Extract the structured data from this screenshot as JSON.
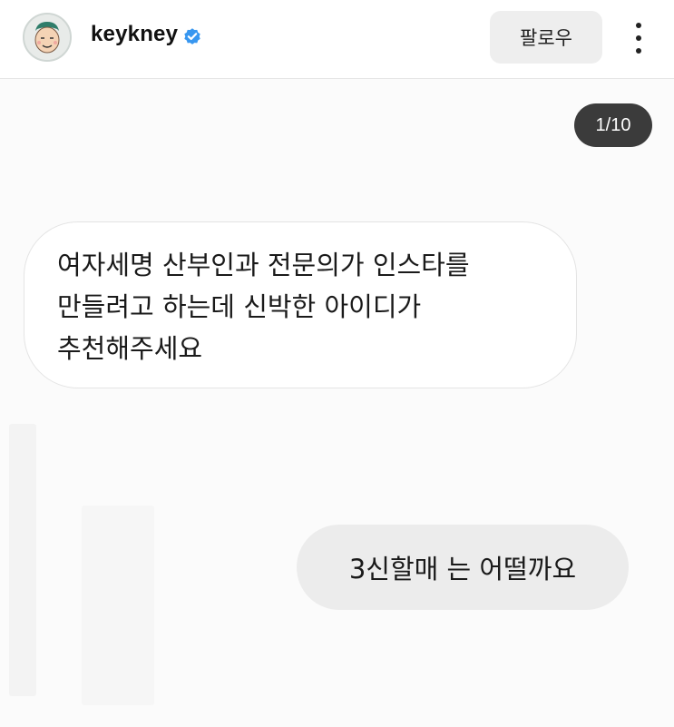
{
  "header": {
    "username": "keykney",
    "verified_icon": "verified-badge-icon",
    "follow_label": "팔로우",
    "more_icon": "more-vertical-icon",
    "avatar_icon": "avatar-cartoon-face"
  },
  "post": {
    "page_counter": "1/10",
    "messages": [
      {
        "side": "left",
        "text": "여자세명 산부인과 전문의가 인스타를\n만들려고 하는데 신박한 아이디가\n추천해주세요"
      },
      {
        "side": "right",
        "text": "3신할매 는 어떨까요"
      }
    ]
  },
  "colors": {
    "verified_blue": "#3897f0",
    "counter_bg": "#3b3b3b",
    "right_bubble_bg": "#ececec",
    "follow_bg": "#eeeeee"
  }
}
